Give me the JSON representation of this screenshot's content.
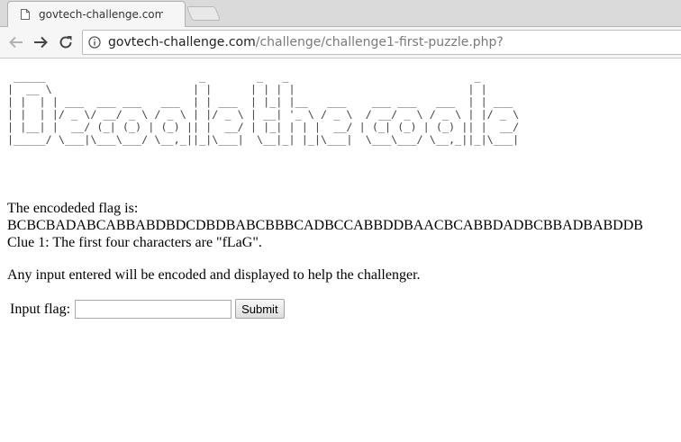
{
  "browser": {
    "tab_title": "govtech-challenge.com/c",
    "url_host": "govtech-challenge.com",
    "url_path": "/challenge/challenge1-first-puzzle.php?"
  },
  "icons": {
    "favicon": "document-icon",
    "back": "back-arrow-icon",
    "forward": "forward-arrow-icon",
    "reload": "reload-icon",
    "site_info": "info-icon"
  },
  "page": {
    "banner_text": "Decode the code",
    "encoded_label": "The encodeded flag is:",
    "encoded_flag": "BCBCBADABCABBABDBDCDBDBABCBBBCADBCCABBDDBAACBCABBDADBCBBADBABDDB",
    "clue": "Clue 1: The first four characters are \"fLaG\".",
    "info": "Any input entered will be encoded and displayed to help the challenger.",
    "input_label": "Input flag:",
    "input_value": "",
    "submit_label": "Submit"
  }
}
